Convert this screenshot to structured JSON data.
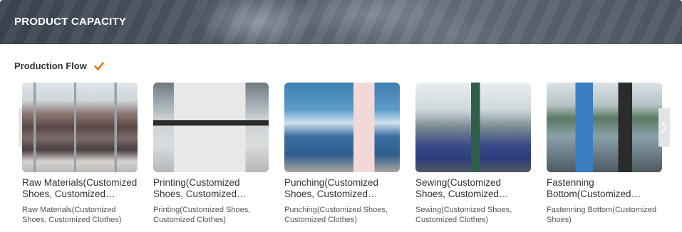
{
  "banner": {
    "title": "PRODUCT CAPACITY"
  },
  "section": {
    "title": "Production Flow",
    "icon": "check-icon",
    "icon_color": "#e8730c"
  },
  "carousel": {
    "prev_icon": "chevron-left-icon",
    "next_icon": "chevron-right-icon",
    "items": [
      {
        "title": "Raw Materials(Customized Shoes, Customized Clothes)",
        "description": "Raw Materials(Customized Shoes, Customized Clothes)",
        "image": "raw-materials-photo"
      },
      {
        "title": "Printing(Customized Shoes, Customized Clothes)",
        "description": "Printing(Customized Shoes, Customized Clothes)",
        "image": "printing-photo"
      },
      {
        "title": "Punching(Customized Shoes, Customized Clothes)",
        "description": "Punching(Customized Shoes, Customized Clothes)",
        "image": "punching-photo"
      },
      {
        "title": "Sewing(Customized Shoes, Customized Clothes)",
        "description": "Sewing(Customized Shoes, Customized Clothes)",
        "image": "sewing-photo"
      },
      {
        "title": "Fastenning Bottom(Customized Shoes, Customized Clothes)",
        "description": "Fastenning Bottom(Customized Shoes)",
        "image": "fastening-bottom-photo"
      }
    ]
  }
}
